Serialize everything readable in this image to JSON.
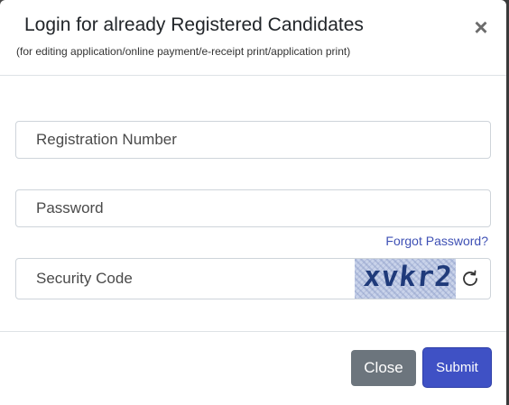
{
  "modal": {
    "title": "Login for already Registered Candidates",
    "subtitle": "(for editing application/online payment/e-receipt print/application print)",
    "close_symbol": "×"
  },
  "form": {
    "registration_placeholder": "Registration Number",
    "registration_value": "",
    "password_placeholder": "Password",
    "password_value": "",
    "forgot_password_label": "Forgot Password?",
    "security_code_placeholder": "Security Code",
    "security_code_value": "",
    "captcha_text": "xvkr2"
  },
  "footer": {
    "close_label": "Close",
    "submit_label": "Submit"
  },
  "colors": {
    "primary": "#3f51c5",
    "secondary": "#6c757d",
    "link": "#3f51b5"
  },
  "icons": {
    "close": "close-icon",
    "refresh": "refresh-icon"
  }
}
